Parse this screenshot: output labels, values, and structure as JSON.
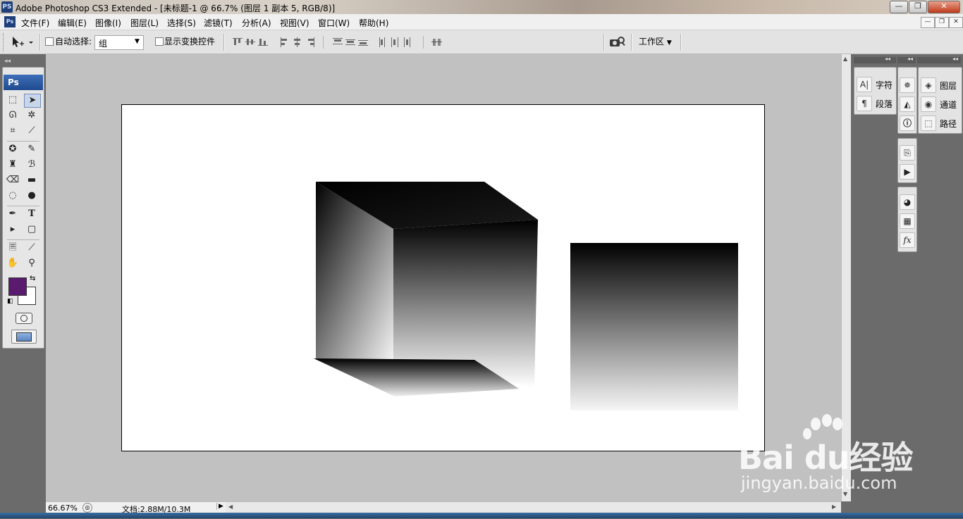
{
  "titlebar": {
    "app_icon": "PS",
    "title": "Adobe Photoshop CS3 Extended - [未标题-1 @ 66.7% (图层 1 副本 5, RGB/8)]",
    "minimize": "—",
    "maximize": "❐",
    "close": "✕"
  },
  "menubar": {
    "icon": "Ps",
    "items": [
      "文件(F)",
      "编辑(E)",
      "图像(I)",
      "图层(L)",
      "选择(S)",
      "滤镜(T)",
      "分析(A)",
      "视图(V)",
      "窗口(W)",
      "帮助(H)"
    ],
    "doc_minimize": "—",
    "doc_restore": "❐",
    "doc_close": "✕"
  },
  "options": {
    "auto_select_label": "自动选择:",
    "auto_select_value": "组",
    "show_transform_label": "显示变换控件",
    "workspace_label": "工作区"
  },
  "toolbox": {
    "brand": "Ps",
    "foreground_color": "#5a1a6e",
    "background_color": "#ffffff"
  },
  "panels": {
    "group1": [
      {
        "icon": "A|",
        "label": "字符"
      },
      {
        "icon": "¶",
        "label": "段落"
      }
    ],
    "group3": [
      {
        "icon": "◈",
        "label": "图层"
      },
      {
        "icon": "◉",
        "label": "通道"
      },
      {
        "icon": "⬚",
        "label": "路径"
      }
    ]
  },
  "status": {
    "zoom": "66.67%",
    "doc_info": "文档:2.88M/10.3M"
  },
  "watermark": {
    "brand": "Bai du经验",
    "url": "jingyan.baidu.com"
  }
}
